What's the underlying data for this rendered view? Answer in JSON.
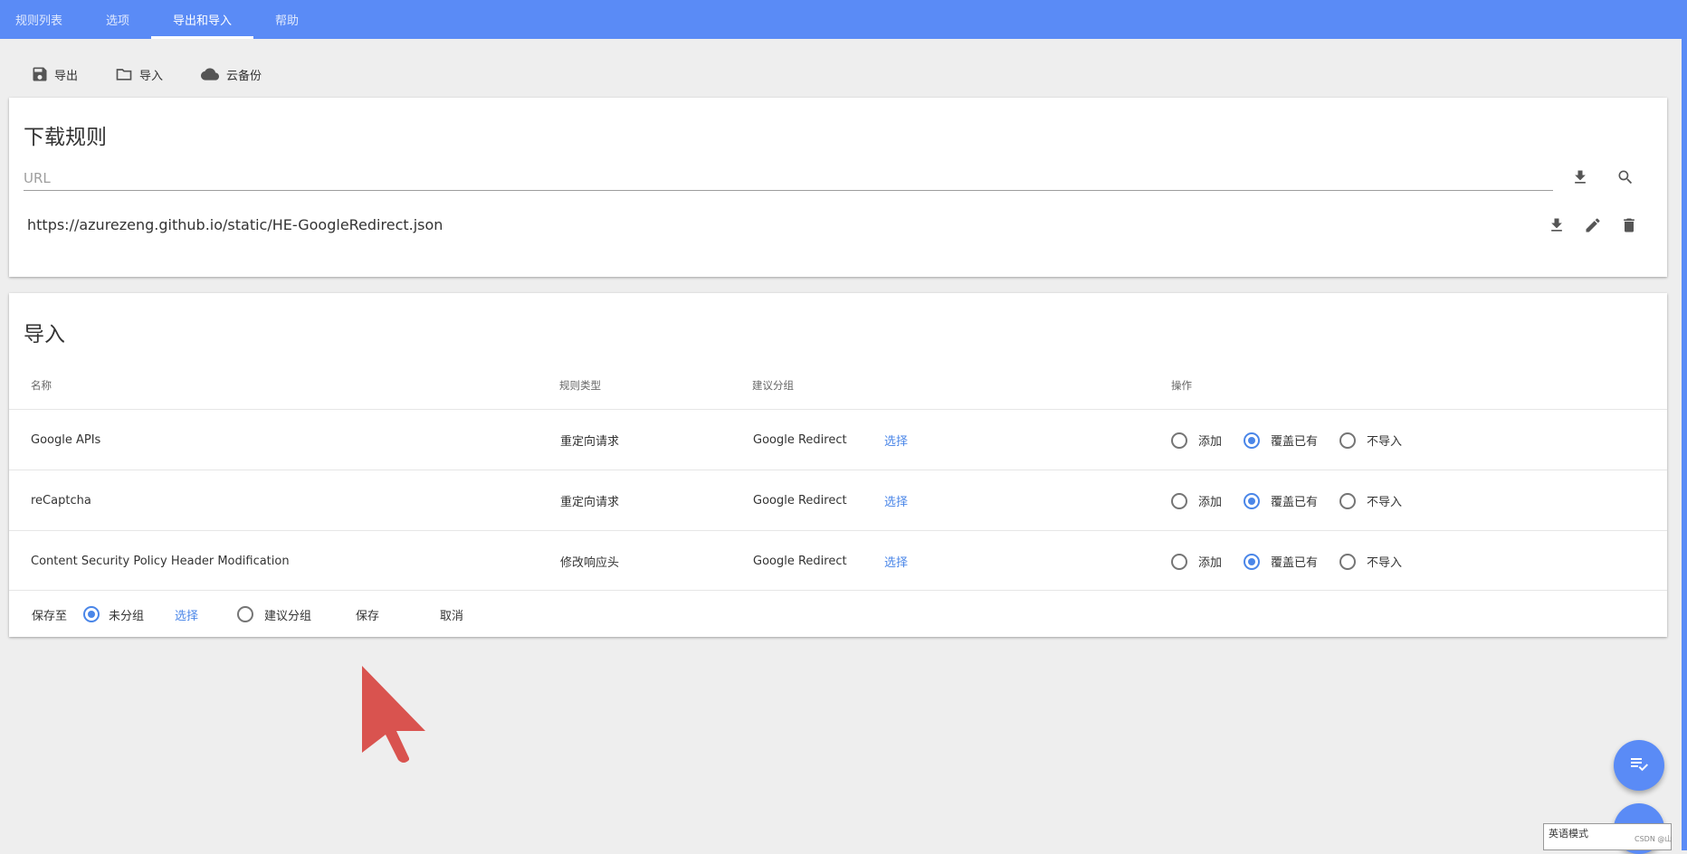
{
  "nav": {
    "tabs": [
      {
        "label": "规则列表"
      },
      {
        "label": "选项"
      },
      {
        "label": "导出和导入"
      },
      {
        "label": "帮助"
      }
    ],
    "active_tab": "导出和导入"
  },
  "toolbar": {
    "export_label": "导出",
    "import_label": "导入",
    "cloud_label": "云备份"
  },
  "download": {
    "title": "下载规则",
    "url_placeholder": "URL",
    "url_value": "",
    "rules": [
      {
        "url": "https://azurezeng.github.io/static/HE-GoogleRedirect.json"
      }
    ]
  },
  "import": {
    "title": "导入",
    "columns": {
      "name": "名称",
      "type": "规则类型",
      "group": "建议分组",
      "action": "操作"
    },
    "select_label": "选择",
    "action_labels": {
      "add": "添加",
      "overwrite": "覆盖已有",
      "skip": "不导入"
    },
    "rows": [
      {
        "name": "Google APIs",
        "type": "重定向请求",
        "group": "Google Redirect",
        "action": "overwrite"
      },
      {
        "name": "reCaptcha",
        "type": "重定向请求",
        "group": "Google Redirect",
        "action": "overwrite"
      },
      {
        "name": "Content Security Policy Header Modification",
        "type": "修改响应头",
        "group": "Google Redirect",
        "action": "overwrite"
      }
    ],
    "footer": {
      "save_to_label": "保存至",
      "ungrouped_label": "未分组",
      "select_label": "选择",
      "suggested_group_label": "建议分组",
      "save_label": "保存",
      "cancel_label": "取消",
      "selected": "ungrouped"
    }
  },
  "ime": {
    "label": "英语模式"
  },
  "watermark": {
    "text": "CSDN @山"
  },
  "colors": {
    "accent": "#5a8bf6",
    "link": "#4a86e8",
    "cursor": "#d9534f"
  }
}
